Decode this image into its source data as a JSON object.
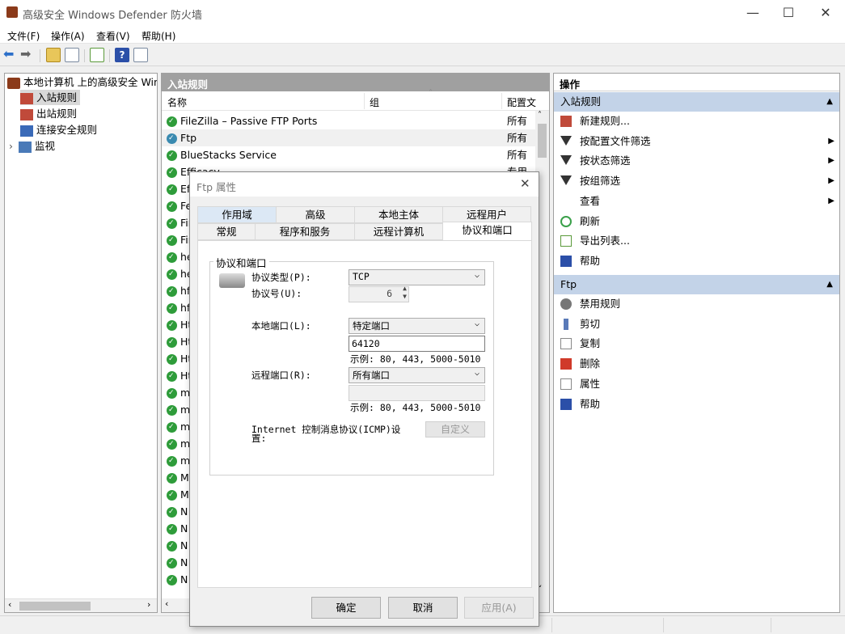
{
  "window": {
    "title": "高级安全 Windows Defender 防火墙",
    "controls": {
      "minimize": "—",
      "maximize": "☐",
      "close": "✕"
    }
  },
  "menubar": [
    {
      "label": "文件(F)"
    },
    {
      "label": "操作(A)"
    },
    {
      "label": "查看(V)"
    },
    {
      "label": "帮助(H)"
    }
  ],
  "tree": {
    "root": "本地计算机 上的高级安全 Windows Defender 防火墙",
    "items": [
      {
        "label": "入站规则"
      },
      {
        "label": "出站规则"
      },
      {
        "label": "连接安全规则"
      },
      {
        "label": "监视"
      }
    ]
  },
  "list": {
    "header": "入站规则",
    "columns": {
      "name": "名称",
      "group": "组",
      "profile": "配置文"
    },
    "rows": [
      {
        "name": "FileZilla – Passive FTP Ports",
        "profile": "所有"
      },
      {
        "name": "Ftp",
        "profile": "所有"
      },
      {
        "name": "BlueStacks Service",
        "profile": "所有"
      },
      {
        "name": "Efficacy",
        "profile": "专用"
      },
      {
        "name": "Ef",
        "profile": ""
      },
      {
        "name": "Fe",
        "profile": ""
      },
      {
        "name": "Fir",
        "profile": ""
      },
      {
        "name": "Fir",
        "profile": ""
      },
      {
        "name": "he",
        "profile": ""
      },
      {
        "name": "he",
        "profile": ""
      },
      {
        "name": "hf",
        "profile": ""
      },
      {
        "name": "hf",
        "profile": ""
      },
      {
        "name": "Ht",
        "profile": ""
      },
      {
        "name": "Ht",
        "profile": ""
      },
      {
        "name": "Ht",
        "profile": ""
      },
      {
        "name": "Ht",
        "profile": ""
      },
      {
        "name": "m",
        "profile": ""
      },
      {
        "name": "m",
        "profile": ""
      },
      {
        "name": "m",
        "profile": ""
      },
      {
        "name": "m",
        "profile": ""
      },
      {
        "name": "m",
        "profile": ""
      },
      {
        "name": "M",
        "profile": ""
      },
      {
        "name": "M",
        "profile": ""
      },
      {
        "name": "N",
        "profile": ""
      },
      {
        "name": "N",
        "profile": ""
      },
      {
        "name": "N",
        "profile": ""
      },
      {
        "name": "N",
        "profile": ""
      },
      {
        "name": "N",
        "profile": ""
      }
    ]
  },
  "actions": {
    "title": "操作",
    "section1": {
      "title": "入站规则",
      "items": [
        {
          "label": "新建规则...",
          "icon": "new-rule-icon",
          "arrow": ""
        },
        {
          "label": "按配置文件筛选",
          "icon": "filter-icon",
          "arrow": "▶"
        },
        {
          "label": "按状态筛选",
          "icon": "filter-icon",
          "arrow": "▶"
        },
        {
          "label": "按组筛选",
          "icon": "filter-icon",
          "arrow": "▶"
        },
        {
          "label": "查看",
          "icon": "",
          "arrow": "▶"
        },
        {
          "label": "刷新",
          "icon": "refresh-icon",
          "arrow": ""
        },
        {
          "label": "导出列表...",
          "icon": "export-icon",
          "arrow": ""
        },
        {
          "label": "帮助",
          "icon": "help-icon",
          "arrow": ""
        }
      ]
    },
    "section2": {
      "title": "Ftp",
      "items": [
        {
          "label": "禁用规则",
          "icon": "disable-icon"
        },
        {
          "label": "剪切",
          "icon": "cut-icon"
        },
        {
          "label": "复制",
          "icon": "copy-icon"
        },
        {
          "label": "删除",
          "icon": "delete-icon"
        },
        {
          "label": "属性",
          "icon": "properties-icon"
        },
        {
          "label": "帮助",
          "icon": "help-icon"
        }
      ]
    }
  },
  "dialog": {
    "title": "Ftp 属性",
    "tabs_row1": [
      "作用域",
      "高级",
      "本地主体",
      "远程用户"
    ],
    "tabs_row2": [
      "常规",
      "程序和服务",
      "远程计算机",
      "协议和端口"
    ],
    "group_title": "协议和端口",
    "protocol_type_label": "协议类型(P):",
    "protocol_type_value": "TCP",
    "protocol_number_label": "协议号(U):",
    "protocol_number_value": "6",
    "local_port_label": "本地端口(L):",
    "local_port_value": "特定端口",
    "local_port_input": "64120",
    "local_port_example": "示例: 80, 443, 5000-5010",
    "remote_port_label": "远程端口(R):",
    "remote_port_value": "所有端口",
    "remote_port_input": "",
    "remote_port_example": "示例: 80, 443, 5000-5010",
    "icmp_label": "Internet 控制消息协议(ICMP)设置:",
    "customize_button": "自定义",
    "ok_button": "确定",
    "cancel_button": "取消",
    "apply_button": "应用(A)"
  },
  "colors": {
    "accent": "#c3d3e8",
    "list_header": "#a0a0a0",
    "check_green": "#2e9c3a"
  }
}
